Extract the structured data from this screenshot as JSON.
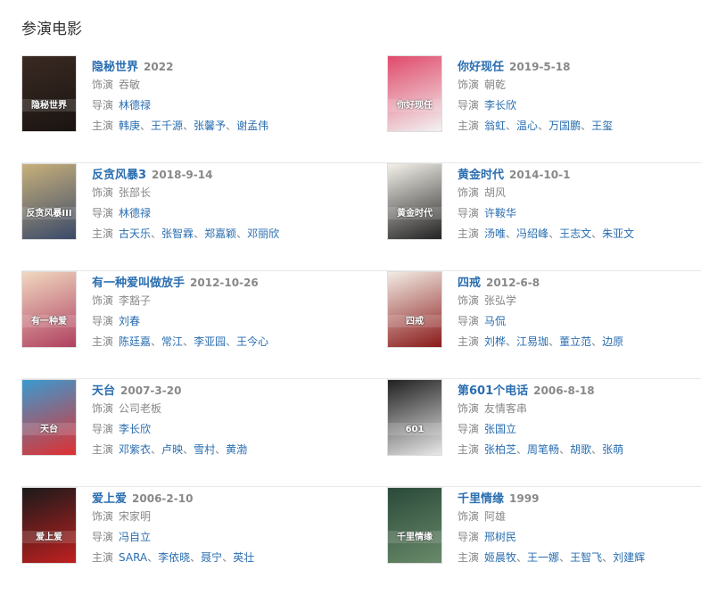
{
  "section": {
    "title": "参演电影"
  },
  "labels": {
    "role": "饰演",
    "director": "导演",
    "cast": "主演"
  },
  "movies": [
    {
      "title": "隐秘世界",
      "date": "2022",
      "role": "吞敏",
      "director": "林德禄",
      "cast": [
        "韩庚",
        "王千源",
        "张馨予",
        "谢孟伟"
      ],
      "poster_colors": [
        "#3a2a22",
        "#1a1412"
      ],
      "poster_text": "隐秘世界"
    },
    {
      "title": "你好现任",
      "date": "2019-5-18",
      "role": "朝乾",
      "director": "李长欣",
      "cast": [
        "翁虹",
        "温心",
        "万国鹏",
        "王玺"
      ],
      "poster_colors": [
        "#e04a6a",
        "#f2f2f2"
      ],
      "poster_text": "你好现任"
    },
    {
      "title": "反贪风暴3",
      "date": "2018-9-14",
      "role": "张部长",
      "director": "林德禄",
      "cast": [
        "古天乐",
        "张智霖",
        "郑嘉颖",
        "邓丽欣"
      ],
      "poster_colors": [
        "#c8b07a",
        "#3a4a6a"
      ],
      "poster_text": "反贪风暴III"
    },
    {
      "title": "黄金时代",
      "date": "2014-10-1",
      "role": "胡风",
      "director": "许鞍华",
      "cast": [
        "汤唯",
        "冯绍峰",
        "王志文",
        "朱亚文"
      ],
      "poster_colors": [
        "#f4f1ea",
        "#222222"
      ],
      "poster_text": "黄金时代"
    },
    {
      "title": "有一种爱叫做放手",
      "date": "2012-10-26",
      "role": "李豁子",
      "director": "刘春",
      "cast": [
        "陈廷嘉",
        "常江",
        "李亚园",
        "王今心"
      ],
      "poster_colors": [
        "#f0d8c0",
        "#b04060"
      ],
      "poster_text": "有一种爱"
    },
    {
      "title": "四戒",
      "date": "2012-6-8",
      "role": "张弘学",
      "director": "马侃",
      "cast": [
        "刘桦",
        "江易珈",
        "董立范",
        "边原"
      ],
      "poster_colors": [
        "#f2ece4",
        "#8a1a1a"
      ],
      "poster_text": "四戒"
    },
    {
      "title": "天台",
      "date": "2007-3-20",
      "role": "公司老板",
      "director": "李长欣",
      "cast": [
        "邓紫衣",
        "卢映",
        "雪村",
        "黄渤"
      ],
      "poster_colors": [
        "#3a9ad0",
        "#e03030"
      ],
      "poster_text": "天台"
    },
    {
      "title": "第601个电话",
      "date": "2006-8-18",
      "role": "友情客串",
      "director": "张国立",
      "cast": [
        "张柏芝",
        "周笔畅",
        "胡歌",
        "张萌"
      ],
      "poster_colors": [
        "#202020",
        "#e8e8e8"
      ],
      "poster_text": "601"
    },
    {
      "title": "爱上爱",
      "date": "2006-2-10",
      "role": "宋家明",
      "director": "冯自立",
      "cast": [
        "SARA",
        "李依晓",
        "聂宁",
        "英壮"
      ],
      "poster_colors": [
        "#1a1a1a",
        "#c02020"
      ],
      "poster_text": "爱上爱"
    },
    {
      "title": "千里情缘",
      "date": "1999",
      "role": "阿雄",
      "director": "邢树民",
      "cast": [
        "姬晨牧",
        "王一娜",
        "王智飞",
        "刘建辉"
      ],
      "poster_colors": [
        "#2a4a3a",
        "#6a8a6a"
      ],
      "poster_text": "千里情缘"
    }
  ]
}
